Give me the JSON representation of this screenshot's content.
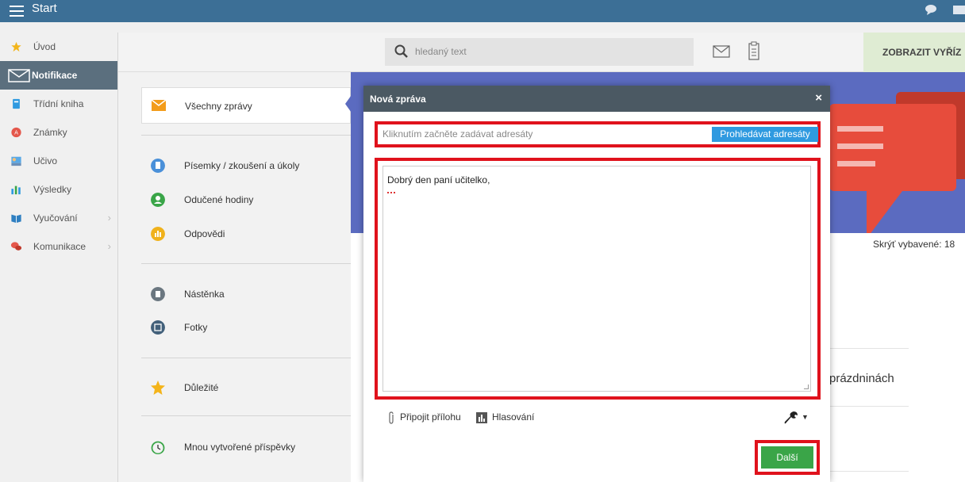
{
  "topbar": {
    "title": "Start"
  },
  "sidebar": {
    "items": [
      {
        "label": "Úvod",
        "icon": "star-icon"
      },
      {
        "label": "Notifikace",
        "icon": "envelope-icon",
        "active": true
      },
      {
        "label": "Třídní kniha",
        "icon": "book-icon"
      },
      {
        "label": "Známky",
        "icon": "grades-icon"
      },
      {
        "label": "Učivo",
        "icon": "teacher-icon"
      },
      {
        "label": "Výsledky",
        "icon": "bar-chart-icon"
      },
      {
        "label": "Vyučování",
        "icon": "open-book-icon",
        "has_submenu": true
      },
      {
        "label": "Komunikace",
        "icon": "chat-bubbles-icon",
        "has_submenu": true
      }
    ]
  },
  "header": {
    "search_placeholder": "hledaný text",
    "show_button": "ZOBRAZIT VYŘÍZ"
  },
  "categories": {
    "all_messages": "Všechny zprávy",
    "items": [
      {
        "label": "Písemky / zkoušení a úkoly",
        "color": "#4a90d9"
      },
      {
        "label": "Odučené hodiny",
        "color": "#3aa548"
      },
      {
        "label": "Odpovědi",
        "color": "#f0b21c"
      },
      {
        "label": "Nástěnka",
        "color": "#6b7780"
      },
      {
        "label": "Fotky",
        "color": "#42607a"
      },
      {
        "label": "Důležité",
        "color": "#f4b41a"
      },
      {
        "label": "Mnou vytvořené příspěvky",
        "color": "#3aa548"
      }
    ]
  },
  "content": {
    "hide_selected": "Skrýť vybavené: 18",
    "partial_text": "prázdninách"
  },
  "modal": {
    "title": "Nová zpráva",
    "close": "×",
    "recipients_placeholder": "Kliknutím začněte zadávat adresáty",
    "browse_recipients": "Prohledávat adresáty",
    "message_text": "Dobrý den paní učitelko,",
    "attach": "Připojit přílohu",
    "poll": "Hlasování",
    "next": "Další"
  },
  "colors": {
    "topbar": "#3c6f96",
    "accent_blue": "#2f9ae0",
    "highlight_red": "#e0121c",
    "next_green": "#3aa548",
    "banner": "#5b6bc0"
  }
}
